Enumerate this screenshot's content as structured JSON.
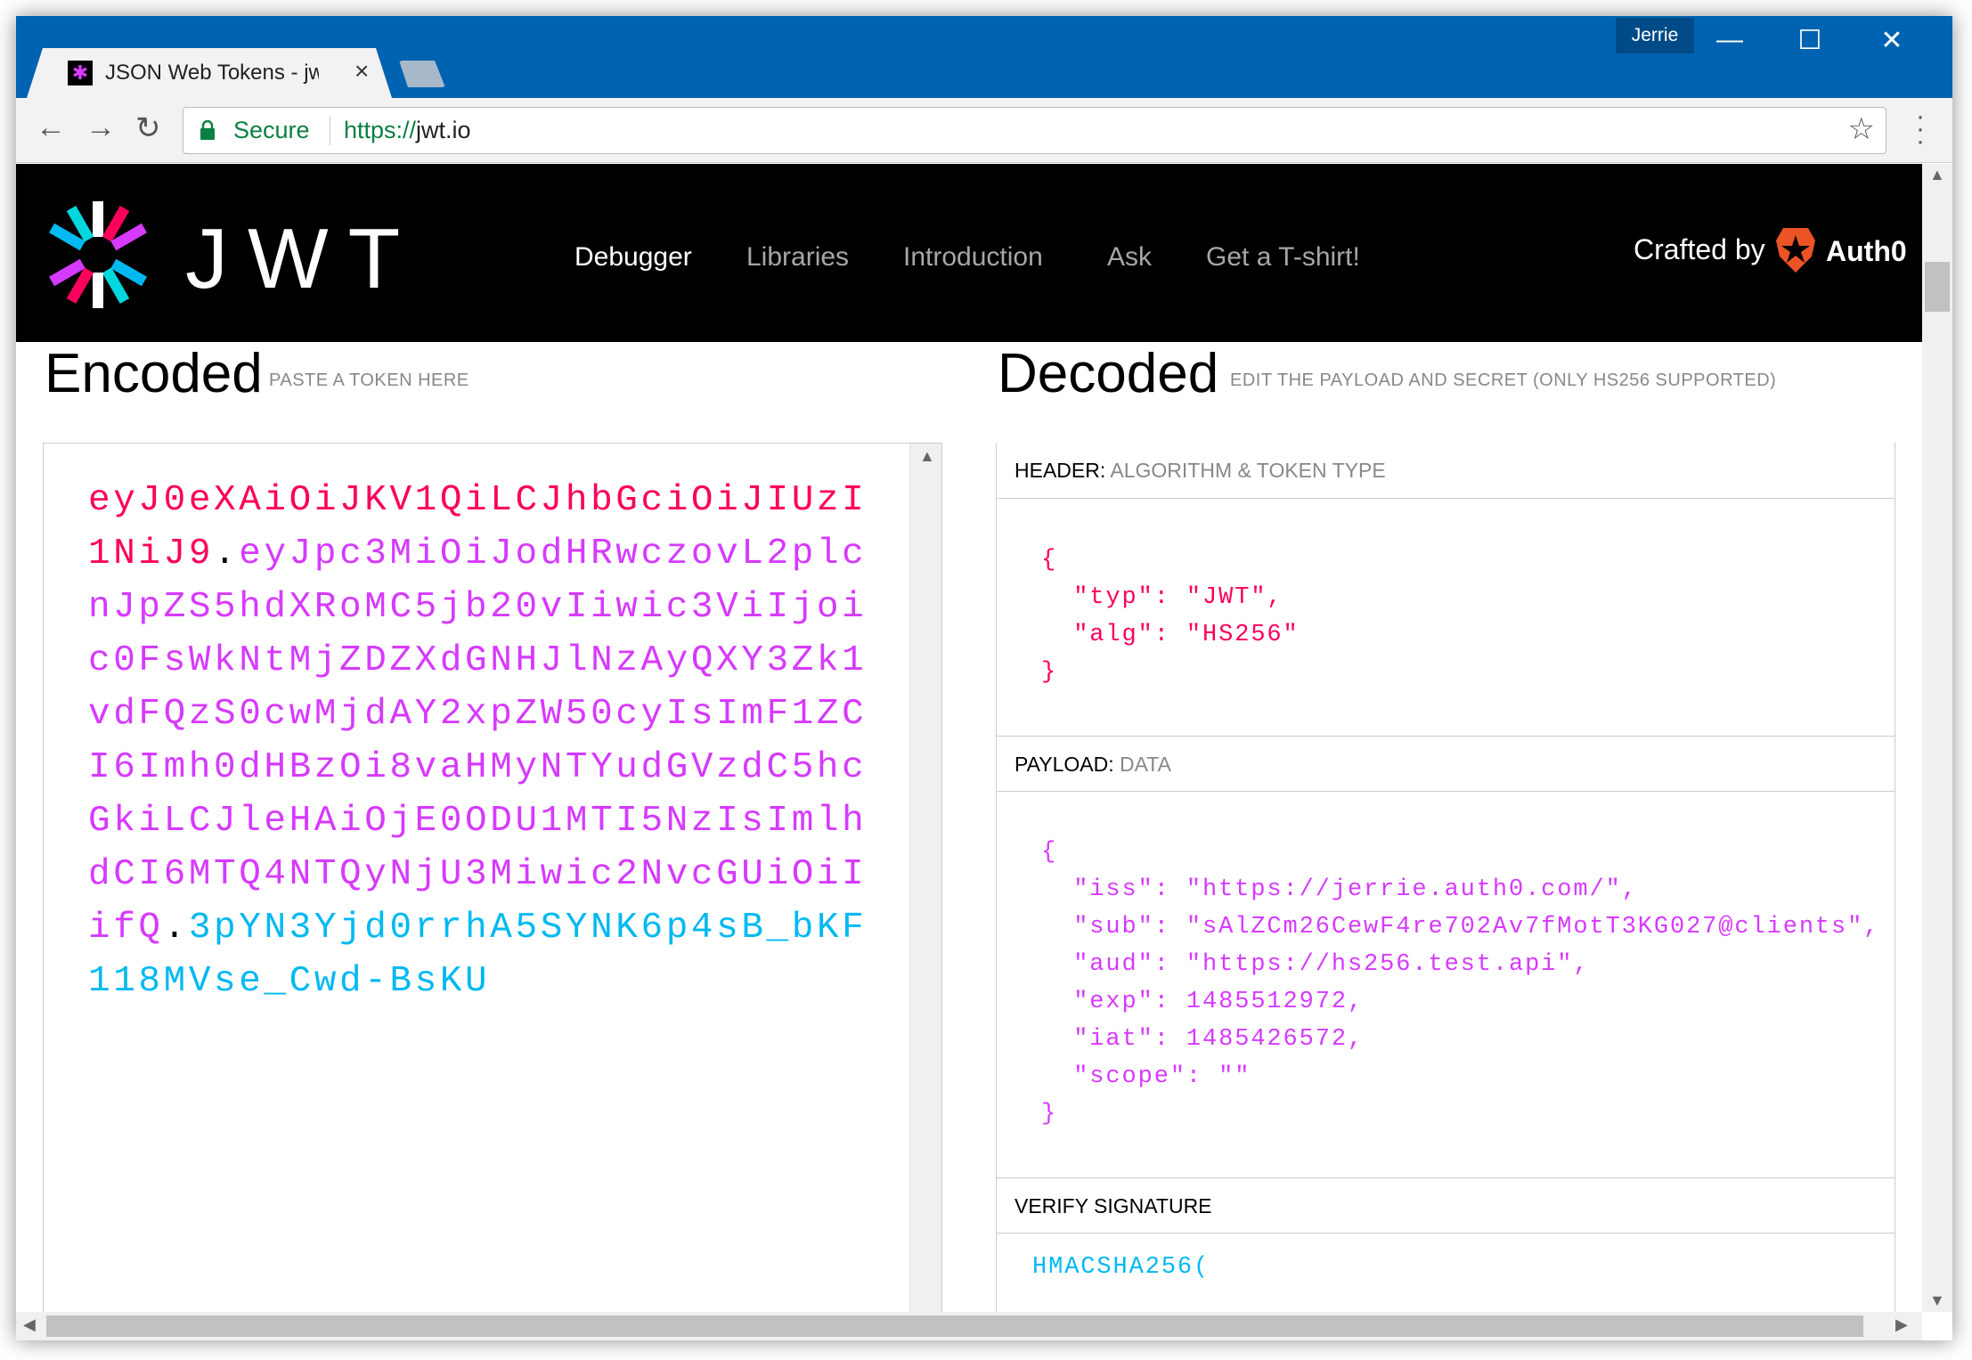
{
  "browser": {
    "tab_title": "JSON Web Tokens - jwt.io",
    "user": "Jerrie",
    "secure_label": "Secure",
    "url_scheme": "https://",
    "url_host": "jwt.io"
  },
  "site": {
    "logo_text": "JWT",
    "nav": [
      "Debugger",
      "Libraries",
      "Introduction",
      "Ask",
      "Get a T-shirt!"
    ],
    "active_nav": "Debugger",
    "crafted_by": "Crafted by",
    "brand": "Auth0"
  },
  "encoded": {
    "title": "Encoded",
    "subtitle": "PASTE A TOKEN HERE",
    "token_header": "eyJ0eXAiOiJKV1QiLCJhbGciOiJIUzI1NiJ9",
    "token_payload": "eyJpc3MiOiJodHRwczovL2plcnJpZS5hdXRoMC5jb20vIiwic3ViIjoic0FsWkNtMjZDZXdGNHJlNzAyQXY3Zk1vdFQzS0cwMjdAY2xpZW50cyIsImF1ZCI6Imh0dHBzOi8vaHMyNTYudGVzdC5hcGkiLCJleHAiOjE0ODU1MTI5NzIsImlhdCI6MTQ4NTQyNjU3Miwic2NvcGUiOiIifQ",
    "token_signature": "3pYN3Yjd0rrhA5SYNK6p4sB_bKF118MVse_Cwd-BsKU",
    "dot": "."
  },
  "decoded": {
    "title": "Decoded",
    "subtitle": "EDIT THE PAYLOAD AND SECRET (ONLY HS256 SUPPORTED)",
    "header_label": "HEADER:",
    "header_sub": "ALGORITHM & TOKEN TYPE",
    "header_json": "{\n  \"typ\": \"JWT\",\n  \"alg\": \"HS256\"\n}",
    "payload_label": "PAYLOAD:",
    "payload_sub": "DATA",
    "payload_json": "{\n  \"iss\": \"https://jerrie.auth0.com/\",\n  \"sub\": \"sAlZCm26CewF4re702Av7fMotT3KG027@clients\",\n  \"aud\": \"https://hs256.test.api\",\n  \"exp\": 1485512972,\n  \"iat\": 1485426572,\n  \"scope\": \"\"\n}",
    "verify_label": "VERIFY SIGNATURE",
    "verify_code": "HMACSHA256("
  },
  "colors": {
    "header": "#fb015b",
    "payload": "#d63aff",
    "signature": "#00b9f1",
    "titlebar": "#0063b1"
  }
}
